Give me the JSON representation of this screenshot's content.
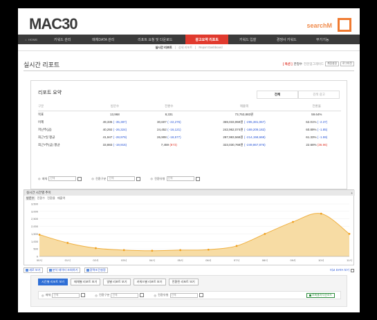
{
  "header": {
    "logo": "MAC30",
    "brand": "searchM",
    "colors": {
      "accent": "#e03a2e",
      "nav_bg": "#3b3b3b",
      "brand": "#f07a30",
      "up": "#2855d6",
      "down": "#e03a2e"
    }
  },
  "nav": {
    "home": "HOME",
    "items": [
      "키워드 관리",
      "매체DATA 관리",
      "리포트 요청 및 다운로드",
      "광고요약 리포트",
      "키워드 입찰",
      "경쟁사 키워드",
      "부가기능"
    ],
    "active_index": 3
  },
  "subnav": {
    "items": [
      "실시간 리포트",
      "상세 리포트",
      "Report Dashboard"
    ],
    "active_index": 0
  },
  "page": {
    "title": "실시간 리포트",
    "title_right": {
      "label": "[ 옥션 ]",
      "extra": "한정수",
      "small": "전문업그레이드",
      "buttons": [
        "계정설정",
        "로그아웃"
      ]
    }
  },
  "summary": {
    "title": "리포트 요약",
    "tabs": [
      "전체",
      "검색 광고"
    ],
    "columns": [
      "구분",
      "방문수",
      "전환수",
      "매출액",
      "전환율"
    ],
    "rows": [
      {
        "label": "목표",
        "visits": "13,968",
        "visits_chg": "",
        "conv": "8,331",
        "conv_chg": "",
        "sales": "73,753,883원",
        "sales_chg": "",
        "rate": "59.64%",
        "rate_chg": ""
      },
      {
        "label": "어제",
        "visits": "49,335",
        "visits_chg": "( -35,387)",
        "conv": "30,607",
        "conv_chg": "( -22,276)",
        "sales": "369,033,959원",
        "sales_chg": "( -295,381,067)",
        "rate": "62.01%",
        "rate_chg": "( -2.37)"
      },
      {
        "label": "지난주(금)",
        "visits": "40,292",
        "visits_chg": "( -26,324)",
        "conv": "24,452",
        "conv_chg": "( -16,121)",
        "sales": "242,962,074원",
        "sales_chg": "( -169,209,182)",
        "rate": "60.89%",
        "rate_chg": "( -1.85)"
      },
      {
        "label": "최근7일 평균",
        "visits": "41,947",
        "visits_chg": "( -28,979)",
        "conv": "26,908",
        "conv_chg": "( -18,577)",
        "sales": "287,983,568원",
        "sales_chg": "( -214,158,668)",
        "rate": "61.33%",
        "rate_chg": "( -1.59)"
      },
      {
        "label": "최근7주(금) 평균",
        "visits": "33,883",
        "visits_chg": "( -19,915)",
        "conv": "7,459",
        "conv_chg": "(873)",
        "sales": "323,030,768원",
        "sales_chg": "( -249,867,876)",
        "rate": "22.68%",
        "rate_chg": "(36.96)"
      }
    ],
    "filters": [
      {
        "label": "매체",
        "value": "전체"
      },
      {
        "label": "전환구분",
        "value": "전체"
      },
      {
        "label": "전환유형",
        "value": "전체"
      }
    ]
  },
  "chart_section": {
    "title": "실시간 시간별 추이",
    "tabs": [
      "방문수",
      "전환수",
      "전환율",
      "매출액"
    ],
    "active_tab": 0
  },
  "chart_data": {
    "type": "area",
    "x": [
      "00시",
      "01시",
      "02시",
      "03시",
      "04시",
      "05시",
      "06시",
      "07시",
      "08시",
      "09시",
      "10시",
      "11시"
    ],
    "values": [
      1450,
      900,
      550,
      420,
      380,
      420,
      450,
      700,
      1500,
      2300,
      2850,
      1500
    ],
    "ylim": [
      0,
      3500
    ],
    "yticks": [
      "0",
      "500",
      "1,000",
      "1,500",
      "2,000",
      "2,500",
      "3,000",
      "3,500"
    ],
    "colors": {
      "fill": "#f7dca4",
      "line": "#f0b040",
      "point": "#f0a020"
    }
  },
  "chart_links": {
    "items": [
      "세로 보기",
      "분석 데이터 조회하기",
      "광역조건설정"
    ],
    "right": "비교 DATA 보기"
  },
  "report_buttons": [
    "시간별 리포트 보기",
    "매체별 리포트 보기",
    "일별 리포트 보기",
    "키워드별 리포트 보기",
    "전환된 리포트 보기"
  ],
  "bottom_filters": [
    {
      "label": "매체",
      "value": "전체"
    },
    {
      "label": "전환구분",
      "value": "전체"
    },
    {
      "label": "전환유형",
      "value": "전체"
    }
  ],
  "download": "조회결과 다운로드"
}
